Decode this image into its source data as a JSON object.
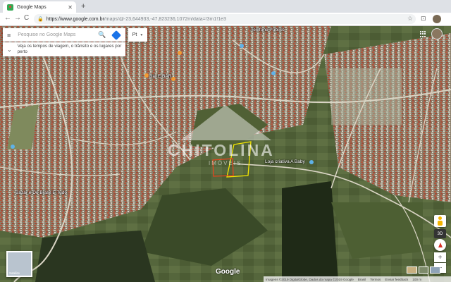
{
  "browser": {
    "tab_title": "Google Maps",
    "tab_close": "✕",
    "new_tab": "+",
    "back": "←",
    "forward": "→",
    "reload": "C",
    "lock": "🔒",
    "url_host": "https://www.google.com.br",
    "url_rest": "/maps/@-23,644933,-47,823236,1072m/data=!3m1!1e3",
    "star": "☆",
    "cast": "⊡"
  },
  "search": {
    "menu": "≡",
    "placeholder": "Pesquise no Google Maps",
    "search_icon": "🔍"
  },
  "travel": {
    "chevron": "⌄",
    "text": "Veja os tempos de viagem, o trânsito e os lugares por perto"
  },
  "language": {
    "label": "Pt",
    "caret": "▼"
  },
  "labels": {
    "telefone": "Telefone Público",
    "bar": "Bar",
    "bar2": "Bar E BAR",
    "loja": "Loja criativa A Baby",
    "bazar": "Bazar e Do Brasil E Tudo",
    "google": "Google"
  },
  "watermark": {
    "brand": "CHITOLINA",
    "sub": "IMÓVEIS"
  },
  "layers_label": "Satélite",
  "controls": {
    "btn3d": "3D",
    "zoom_in": "+",
    "zoom_out": "−"
  },
  "attribution": {
    "imagery": "Imagens ©2019 DigitalGlobe, Dados do mapa ©2019 Google",
    "country": "Brasil",
    "terms": "Termos",
    "feedback": "Enviar feedback",
    "scale": "100 m"
  },
  "colors": {
    "selected_lot": "#f5e600",
    "adjacent_lot": "#e8431c",
    "accent": "#1a73e8"
  }
}
